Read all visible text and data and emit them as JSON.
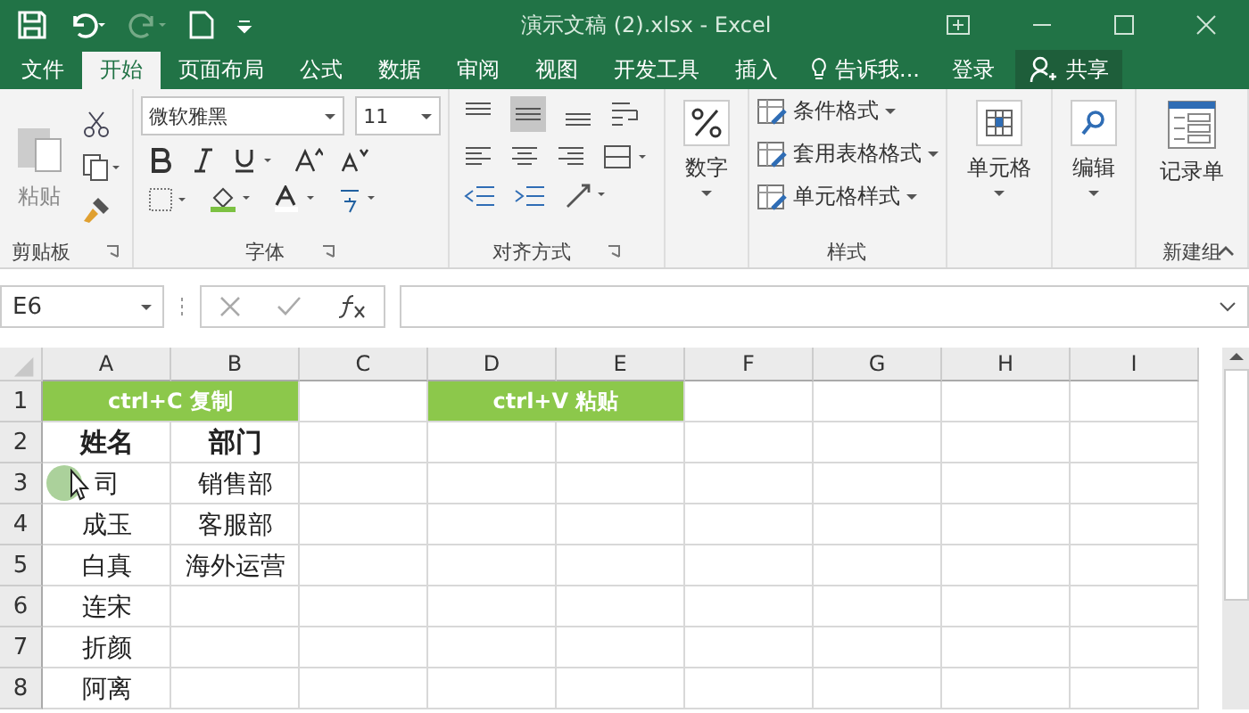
{
  "window": {
    "title": "演示文稿 (2).xlsx - Excel"
  },
  "tabs": [
    {
      "label": "文件",
      "selected": false
    },
    {
      "label": "开始",
      "selected": true
    },
    {
      "label": "页面布局",
      "selected": false
    },
    {
      "label": "公式",
      "selected": false
    },
    {
      "label": "数据",
      "selected": false
    },
    {
      "label": "审阅",
      "selected": false
    },
    {
      "label": "视图",
      "selected": false
    },
    {
      "label": "开发工具",
      "selected": false
    },
    {
      "label": "插入",
      "selected": false
    }
  ],
  "tell_me": "告诉我...",
  "sign_in": "登录",
  "share": "共享",
  "ribbon": {
    "clipboard": {
      "paste": "粘贴",
      "label": "剪贴板"
    },
    "font": {
      "font_name": "微软雅黑",
      "font_size": "11",
      "label": "字体"
    },
    "alignment": {
      "label": "对齐方式"
    },
    "number": {
      "button": "数字"
    },
    "styles": {
      "items": [
        "条件格式",
        "套用表格格式",
        "单元格样式"
      ],
      "label": "样式"
    },
    "cells": {
      "button": "单元格"
    },
    "editing": {
      "button": "编辑"
    },
    "new_group": {
      "button": "记录单",
      "label": "新建组"
    }
  },
  "formula_bar": {
    "name_box": "E6"
  },
  "sheet": {
    "columns": [
      "A",
      "B",
      "C",
      "D",
      "E",
      "F",
      "G",
      "H",
      "I"
    ],
    "rows": [
      {
        "number": "1",
        "cells": [
          {
            "kind": "banner",
            "text": "ctrl+C 复制"
          },
          {
            "kind": "blank"
          },
          {
            "kind": "banner",
            "text": "ctrl+V 粘贴"
          },
          {
            "kind": "blank"
          },
          {
            "kind": "blank"
          },
          {
            "kind": "blank"
          },
          {
            "kind": "blank"
          }
        ]
      },
      {
        "number": "2",
        "cells": [
          {
            "kind": "heading",
            "text": "姓名"
          },
          {
            "kind": "heading",
            "text": "部门"
          },
          {
            "kind": "blank"
          },
          {
            "kind": "blank"
          },
          {
            "kind": "blank"
          },
          {
            "kind": "blank"
          },
          {
            "kind": "blank"
          },
          {
            "kind": "blank"
          },
          {
            "kind": "blank"
          }
        ]
      },
      {
        "number": "3",
        "cells": [
          {
            "kind": "text",
            "text": "司"
          },
          {
            "kind": "text",
            "text": "销售部"
          },
          {
            "kind": "blank"
          },
          {
            "kind": "blank"
          },
          {
            "kind": "blank"
          },
          {
            "kind": "blank"
          },
          {
            "kind": "blank"
          },
          {
            "kind": "blank"
          },
          {
            "kind": "blank"
          }
        ]
      },
      {
        "number": "4",
        "cells": [
          {
            "kind": "text",
            "text": "成玉"
          },
          {
            "kind": "text",
            "text": "客服部"
          },
          {
            "kind": "blank"
          },
          {
            "kind": "blank"
          },
          {
            "kind": "blank"
          },
          {
            "kind": "blank"
          },
          {
            "kind": "blank"
          },
          {
            "kind": "blank"
          },
          {
            "kind": "blank"
          }
        ]
      },
      {
        "number": "5",
        "cells": [
          {
            "kind": "text",
            "text": "白真"
          },
          {
            "kind": "text",
            "text": "海外运营"
          },
          {
            "kind": "blank"
          },
          {
            "kind": "blank"
          },
          {
            "kind": "blank"
          },
          {
            "kind": "blank"
          },
          {
            "kind": "blank"
          },
          {
            "kind": "blank"
          },
          {
            "kind": "blank"
          }
        ]
      },
      {
        "number": "6",
        "cells": [
          {
            "kind": "text",
            "text": "连宋"
          },
          {
            "kind": "blank"
          },
          {
            "kind": "blank"
          },
          {
            "kind": "blank"
          },
          {
            "kind": "blank"
          },
          {
            "kind": "blank"
          },
          {
            "kind": "blank"
          },
          {
            "kind": "blank"
          },
          {
            "kind": "blank"
          }
        ]
      },
      {
        "number": "7",
        "cells": [
          {
            "kind": "text",
            "text": "折颜"
          },
          {
            "kind": "blank"
          },
          {
            "kind": "blank"
          },
          {
            "kind": "blank"
          },
          {
            "kind": "blank"
          },
          {
            "kind": "blank"
          },
          {
            "kind": "blank"
          },
          {
            "kind": "blank"
          },
          {
            "kind": "blank"
          }
        ]
      },
      {
        "number": "8",
        "cells": [
          {
            "kind": "text",
            "text": "阿离"
          },
          {
            "kind": "blank"
          },
          {
            "kind": "blank"
          },
          {
            "kind": "blank"
          },
          {
            "kind": "blank"
          },
          {
            "kind": "blank"
          },
          {
            "kind": "blank"
          },
          {
            "kind": "blank"
          },
          {
            "kind": "blank"
          }
        ]
      }
    ]
  }
}
